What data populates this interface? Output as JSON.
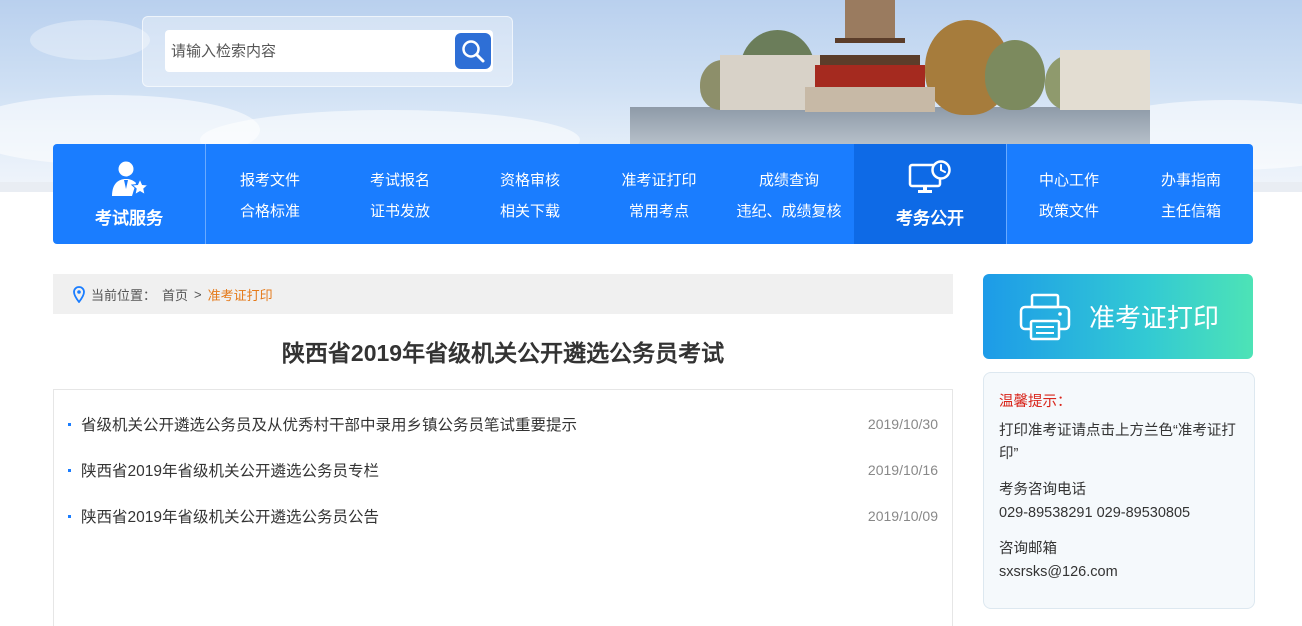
{
  "search": {
    "placeholder": "请输入检索内容",
    "button_icon": "search-icon"
  },
  "nav": {
    "exam_service": {
      "label": "考试服务",
      "icon": "examinee-icon",
      "links": [
        [
          "报考文件",
          "合格标准"
        ],
        [
          "考试报名",
          "证书发放"
        ],
        [
          "资格审核",
          "相关下载"
        ],
        [
          "准考证打印",
          "常用考点"
        ],
        [
          "成绩查询",
          "违纪、成绩复核"
        ]
      ]
    },
    "exam_public": {
      "label": "考务公开",
      "icon": "monitor-clock-icon",
      "links": [
        [
          "中心工作",
          "政策文件"
        ],
        [
          "办事指南",
          "主任信箱"
        ]
      ]
    },
    "accent": "#1a7dff",
    "accent_dark": "#0e6ae6"
  },
  "breadcrumb": {
    "prefix": "当前位置：",
    "home": "首页",
    "separator": ">",
    "current": "准考证打印"
  },
  "page_title": "陕西省2019年省级机关公开遴选公务员考试",
  "articles": [
    {
      "title": "省级机关公开遴选公务员及从优秀村干部中录用乡镇公务员笔试重要提示",
      "date": "2019/10/30"
    },
    {
      "title": "陕西省2019年省级机关公开遴选公务员专栏",
      "date": "2019/10/16"
    },
    {
      "title": "陕西省2019年省级机关公开遴选公务员公告",
      "date": "2019/10/09"
    }
  ],
  "sidebar": {
    "print_button": {
      "label": "准考证打印",
      "icon": "printer-icon"
    },
    "tips": {
      "heading": "温馨提示：",
      "instruction": "打印准考证请点击上方兰色“准考证打印”",
      "phone_label": "考务咨询电话",
      "phone_value": "029-89538291 029-89530805",
      "email_label": "咨询邮箱",
      "email_value": "sxsrsks@126.com"
    }
  }
}
